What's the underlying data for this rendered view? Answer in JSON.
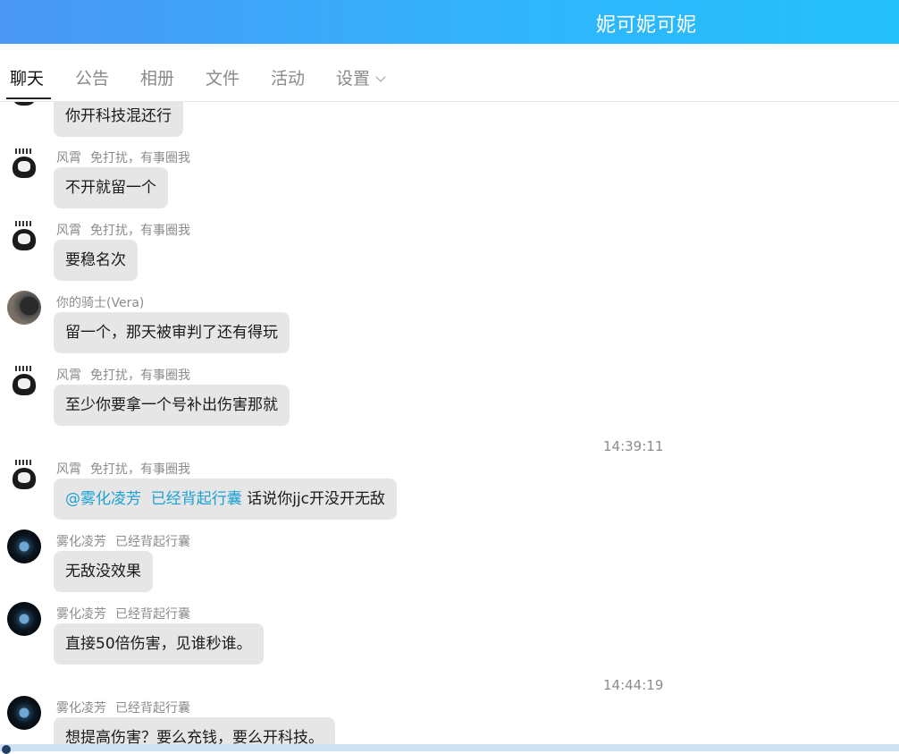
{
  "header": {
    "title": "妮可妮可妮"
  },
  "tabs": [
    {
      "label": "聊天",
      "active": true
    },
    {
      "label": "公告"
    },
    {
      "label": "相册"
    },
    {
      "label": "文件"
    },
    {
      "label": "活动"
    },
    {
      "label": "设置",
      "has_dropdown": true,
      "dropdown_icon": "chevron-down-icon"
    }
  ],
  "messages": [
    {
      "avatar": "skull-avatar",
      "text": "你开科技混还行"
    },
    {
      "sender": "风霄",
      "title": "免打扰，有事圈我",
      "avatar": "skull-avatar",
      "text": "不开就留一个"
    },
    {
      "sender": "风霄",
      "title": "免打扰，有事圈我",
      "avatar": "skull-avatar",
      "text": "要稳名次"
    },
    {
      "sender": "你的骑士(Vera)",
      "avatar": "portrait-avatar",
      "text": "留一个，那天被审判了还有得玩"
    },
    {
      "sender": "风霄",
      "title": "免打扰，有事圈我",
      "avatar": "skull-avatar",
      "text": "至少你要拿一个号补出伤害那就"
    },
    {
      "timestamp": "14:39:11"
    },
    {
      "sender": "风霄",
      "title": "免打扰，有事圈我",
      "avatar": "skull-avatar",
      "mention": "@雾化凌芳  已经背起行囊",
      "text": "话说你jjc开没开无敌"
    },
    {
      "sender": "雾化凌芳",
      "title": "已经背起行囊",
      "avatar": "earth-avatar",
      "text": "无敌没效果"
    },
    {
      "sender": "雾化凌芳",
      "title": "已经背起行囊",
      "avatar": "earth-avatar",
      "text": "直接50倍伤害，见谁秒谁。"
    },
    {
      "timestamp": "14:44:19"
    },
    {
      "sender": "雾化凌芳",
      "title": "已经背起行囊",
      "avatar": "earth-avatar",
      "text": "想提高伤害？要么充钱，要么开科技。"
    }
  ]
}
